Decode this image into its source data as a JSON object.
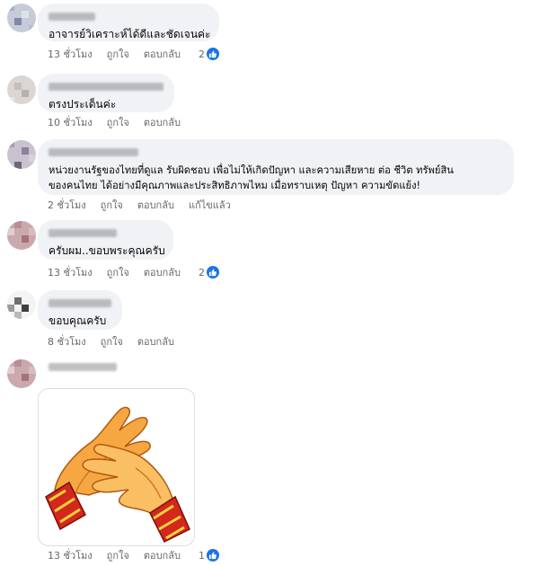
{
  "colors": {
    "bubble": "#f0f2f5",
    "meta": "#65676b",
    "like": "#1b74e4"
  },
  "comments": [
    {
      "text_lines": [
        "อาจารย์วิเคราะห์ได้ดีและชัดเจนค่ะ"
      ],
      "time": "13 ชั่วโมง",
      "like": "ถูกใจ",
      "reply": "ตอบกลับ",
      "edited": "",
      "reactions": "2"
    },
    {
      "text_lines": [
        "ตรงประเด็นค่ะ"
      ],
      "time": "10 ชั่วโมง",
      "like": "ถูกใจ",
      "reply": "ตอบกลับ",
      "edited": "",
      "reactions": ""
    },
    {
      "text_lines": [
        "หน่วยงานรัฐของไทยที่ดูแล รับผิดชอบ เพื่อไม่ให้เกิดปัญหา และความเสียหาย ต่อ ชีวิต ทรัพย์สิน",
        "ของคนไทย ได้อย่างมีคุณภาพและประสิทธิภาพไหม เมื่อทราบเหตุ ปัญหา ความขัดแย้ง!"
      ],
      "time": "2 ชั่วโมง",
      "like": "ถูกใจ",
      "reply": "ตอบกลับ",
      "edited": "แก้ไขแล้ว",
      "reactions": ""
    },
    {
      "text_lines": [
        "ครับผม..ขอบพระคุณครับ"
      ],
      "time": "13 ชั่วโมง",
      "like": "ถูกใจ",
      "reply": "ตอบกลับ",
      "edited": "",
      "reactions": "2"
    },
    {
      "text_lines": [
        "ขอบคุณครับ"
      ],
      "time": "8 ชั่วโมง",
      "like": "ถูกใจ",
      "reply": "ตอบกลับ",
      "edited": "",
      "reactions": ""
    },
    {
      "text_lines": [],
      "sticker": "clapping-hands-sticker",
      "time": "13 ชั่วโมง",
      "like": "ถูกใจ",
      "reply": "ตอบกลับ",
      "edited": "",
      "reactions": "1"
    }
  ]
}
